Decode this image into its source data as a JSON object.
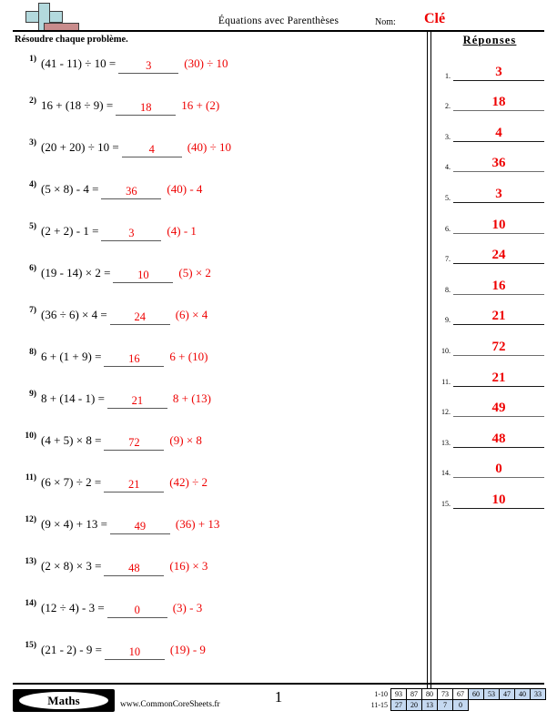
{
  "header": {
    "title": "Équations avec Parenthèses",
    "name_label": "Nom:",
    "name_value": "Clé",
    "logo_icon": "plus-minus-icon"
  },
  "subheader": {
    "instruction": "Résoudre chaque problème.",
    "answers_heading": "Réponses"
  },
  "problems": [
    {
      "num": "1)",
      "expr": "(41 - 11) ÷ 10 =",
      "answer": "3",
      "hint": "(30) ÷ 10"
    },
    {
      "num": "2)",
      "expr": "16 + (18 ÷ 9) =",
      "answer": "18",
      "hint": "16 + (2)"
    },
    {
      "num": "3)",
      "expr": "(20 + 20) ÷ 10 =",
      "answer": "4",
      "hint": "(40) ÷ 10"
    },
    {
      "num": "4)",
      "expr": "(5 × 8) - 4 =",
      "answer": "36",
      "hint": "(40) - 4"
    },
    {
      "num": "5)",
      "expr": "(2 + 2) - 1 =",
      "answer": "3",
      "hint": "(4) - 1"
    },
    {
      "num": "6)",
      "expr": "(19 - 14) × 2 =",
      "answer": "10",
      "hint": "(5) × 2"
    },
    {
      "num": "7)",
      "expr": "(36 ÷ 6) × 4 =",
      "answer": "24",
      "hint": "(6) × 4"
    },
    {
      "num": "8)",
      "expr": "6 + (1 + 9) =",
      "answer": "16",
      "hint": "6 + (10)"
    },
    {
      "num": "9)",
      "expr": "8 + (14 - 1) =",
      "answer": "21",
      "hint": "8 + (13)"
    },
    {
      "num": "10)",
      "expr": "(4 + 5) × 8 =",
      "answer": "72",
      "hint": "(9) × 8"
    },
    {
      "num": "11)",
      "expr": "(6 × 7) ÷ 2 =",
      "answer": "21",
      "hint": "(42) ÷ 2"
    },
    {
      "num": "12)",
      "expr": "(9 × 4) + 13 =",
      "answer": "49",
      "hint": "(36) + 13"
    },
    {
      "num": "13)",
      "expr": "(2 × 8) × 3 =",
      "answer": "48",
      "hint": "(16) × 3"
    },
    {
      "num": "14)",
      "expr": "(12 ÷ 4) - 3 =",
      "answer": "0",
      "hint": "(3) - 3"
    },
    {
      "num": "15)",
      "expr": "(21 - 2) - 9 =",
      "answer": "10",
      "hint": "(19) - 9"
    }
  ],
  "answers": [
    {
      "num": "1.",
      "value": "3"
    },
    {
      "num": "2.",
      "value": "18"
    },
    {
      "num": "3.",
      "value": "4"
    },
    {
      "num": "4.",
      "value": "36"
    },
    {
      "num": "5.",
      "value": "3"
    },
    {
      "num": "6.",
      "value": "10"
    },
    {
      "num": "7.",
      "value": "24"
    },
    {
      "num": "8.",
      "value": "16"
    },
    {
      "num": "9.",
      "value": "21"
    },
    {
      "num": "10.",
      "value": "72"
    },
    {
      "num": "11.",
      "value": "21"
    },
    {
      "num": "12.",
      "value": "49"
    },
    {
      "num": "13.",
      "value": "48"
    },
    {
      "num": "14.",
      "value": "0"
    },
    {
      "num": "15.",
      "value": "10"
    }
  ],
  "footer": {
    "brand": "Maths",
    "url": "www.CommonCoreSheets.fr",
    "page_number": "1",
    "score_table": {
      "rows": [
        {
          "label": "1-10",
          "cells": [
            {
              "value": "93",
              "highlight": false
            },
            {
              "value": "87",
              "highlight": false
            },
            {
              "value": "80",
              "highlight": false
            },
            {
              "value": "73",
              "highlight": false
            },
            {
              "value": "67",
              "highlight": false
            },
            {
              "value": "60",
              "highlight": true
            },
            {
              "value": "53",
              "highlight": true
            },
            {
              "value": "47",
              "highlight": true
            },
            {
              "value": "40",
              "highlight": true
            },
            {
              "value": "33",
              "highlight": true
            }
          ]
        },
        {
          "label": "11-15",
          "cells": [
            {
              "value": "27",
              "highlight": true
            },
            {
              "value": "20",
              "highlight": true
            },
            {
              "value": "13",
              "highlight": true
            },
            {
              "value": "7",
              "highlight": true
            },
            {
              "value": "0",
              "highlight": true
            }
          ]
        }
      ]
    }
  },
  "colors": {
    "answer_red": "#ee0000",
    "highlight_blue": "#c5d9f1",
    "logo_teal": "#b3d9dd",
    "logo_rose": "#c98c8c"
  }
}
